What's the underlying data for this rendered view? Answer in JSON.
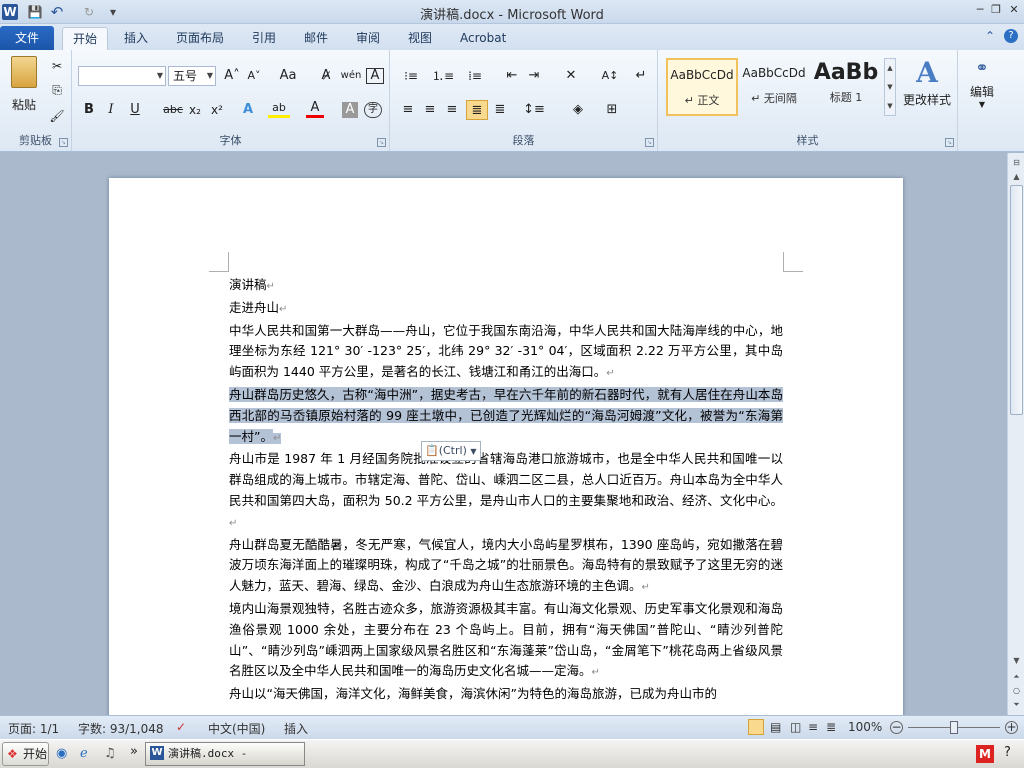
{
  "window": {
    "title": "演讲稿.docx - Microsoft Word",
    "app_icon": "W",
    "qat": {
      "save_icon": "💾",
      "undo_icon": "↶",
      "redo_icon": "↻",
      "customize_icon": "▾"
    },
    "controls": {
      "minimize": "─",
      "restore": "❐",
      "close": "✕"
    },
    "doc_controls": {
      "minimize": "▭",
      "restore": "❐",
      "close": "✕"
    }
  },
  "menu": {
    "file": "文件",
    "tabs": [
      "开始",
      "插入",
      "页面布局",
      "引用",
      "邮件",
      "审阅",
      "视图",
      "Acrobat"
    ],
    "help_icon": "?",
    "collapse_icon": "⌃"
  },
  "ribbon": {
    "clipboard": {
      "paste_label": "粘贴",
      "group_label": "剪贴板"
    },
    "font": {
      "font_name": "",
      "font_size": "五号",
      "grow_icon": "A˄",
      "shrink_icon": "A˅",
      "case_icon": "Aa",
      "clear_icon": "A̷",
      "phonetic_icon": "wén",
      "border_icon": "A",
      "bold": "B",
      "italic": "I",
      "underline": "U",
      "strike": "abc",
      "subscript": "x₂",
      "superscript": "x²",
      "effects_icon": "A",
      "highlight_icon": "ab",
      "fontcolor_icon": "A",
      "shade_icon": "A",
      "enclose_icon": "字",
      "group_label": "字体"
    },
    "paragraph": {
      "group_label": "段落"
    },
    "styles": {
      "items": [
        {
          "preview": "AaBbCcDd",
          "name": "↵ 正文"
        },
        {
          "preview": "AaBbCcDd",
          "name": "↵ 无间隔"
        },
        {
          "preview": "AaBb",
          "name": "标题 1"
        }
      ],
      "change_label": "更改样式",
      "group_label": "样式"
    },
    "editing": {
      "label": "编辑"
    }
  },
  "document": {
    "paragraphs": [
      "演讲稿",
      "走进舟山",
      "中华人民共和国第一大群岛——舟山，它位于我国东南沿海，中华人民共和国大陆海岸线的中心，地理坐标为东经 121° 30′ -123° 25′，北纬 29° 32′ -31° 04′，区域面积 2.22 万平方公里，其中岛屿面积为 1440 平方公里，是著名的长江、钱塘江和甬江的出海口。",
      "舟山群岛历史悠久，古称“海中洲”，据史考古，早在六千年前的新石器时代，就有人居住在舟山本岛西北部的马岙镇原始村落的 99 座土墩中，已创造了光辉灿烂的“海岛河姆渡”文化，被誉为“东海第一村”。",
      "舟山市是 1987 年 1 月经国务院批准设立的省辖海岛港口旅游城市，也是全中华人民共和国唯一以群岛组成的海上城市。市辖定海、普陀、岱山、嵊泗二区二县，总人口近百万。舟山本岛为全中华人民共和国第四大岛，面积为 50.2 平方公里，是舟山市人口的主要集聚地和政治、经济、文化中心。",
      "舟山群岛夏无酷酷暑，冬无严寒，气候宜人，境内大小岛屿星罗棋布，1390 座岛屿，宛如撒落在碧波万顷东海洋面上的璀璨明珠，构成了“千岛之城”的壮丽景色。海岛特有的景致赋予了这里无穷的迷人魅力，蓝天、碧海、绿岛、金沙、白浪成为舟山生态旅游环境的主色调。",
      "境内山海景观独特，名胜古迹众多，旅游资源极其丰富。有山海文化景观、历史军事文化景观和海岛渔俗景观 1000 余处，主要分布在 23 个岛屿上。目前，拥有“海天佛国”普陀山、“睛沙列普陀山”、“睛沙列岛”嵊泗两上国家级风景名胜区和“东海蓬莱”岱山岛，“金屑笔下”桃花岛两上省级风景名胜区以及全中华人民共和国唯一的海岛历史文化名城——定海。",
      "舟山以“海天佛国，海洋文化，海鲜美食，海滨休闲”为特色的海岛旅游，已成为舟山市的"
    ],
    "paste_options": "(Ctrl)",
    "paragraph_mark": "↵"
  },
  "status": {
    "page": "页面: 1/1",
    "words": "字数: 93/1,048",
    "language": "中文(中国)",
    "mode": "插入",
    "zoom": "100%",
    "zoom_out": "−",
    "zoom_in": "+"
  },
  "taskbar": {
    "start": "开始",
    "word_task": "演讲稿.docx - Micro...",
    "more": "»",
    "help_icon": "?"
  }
}
